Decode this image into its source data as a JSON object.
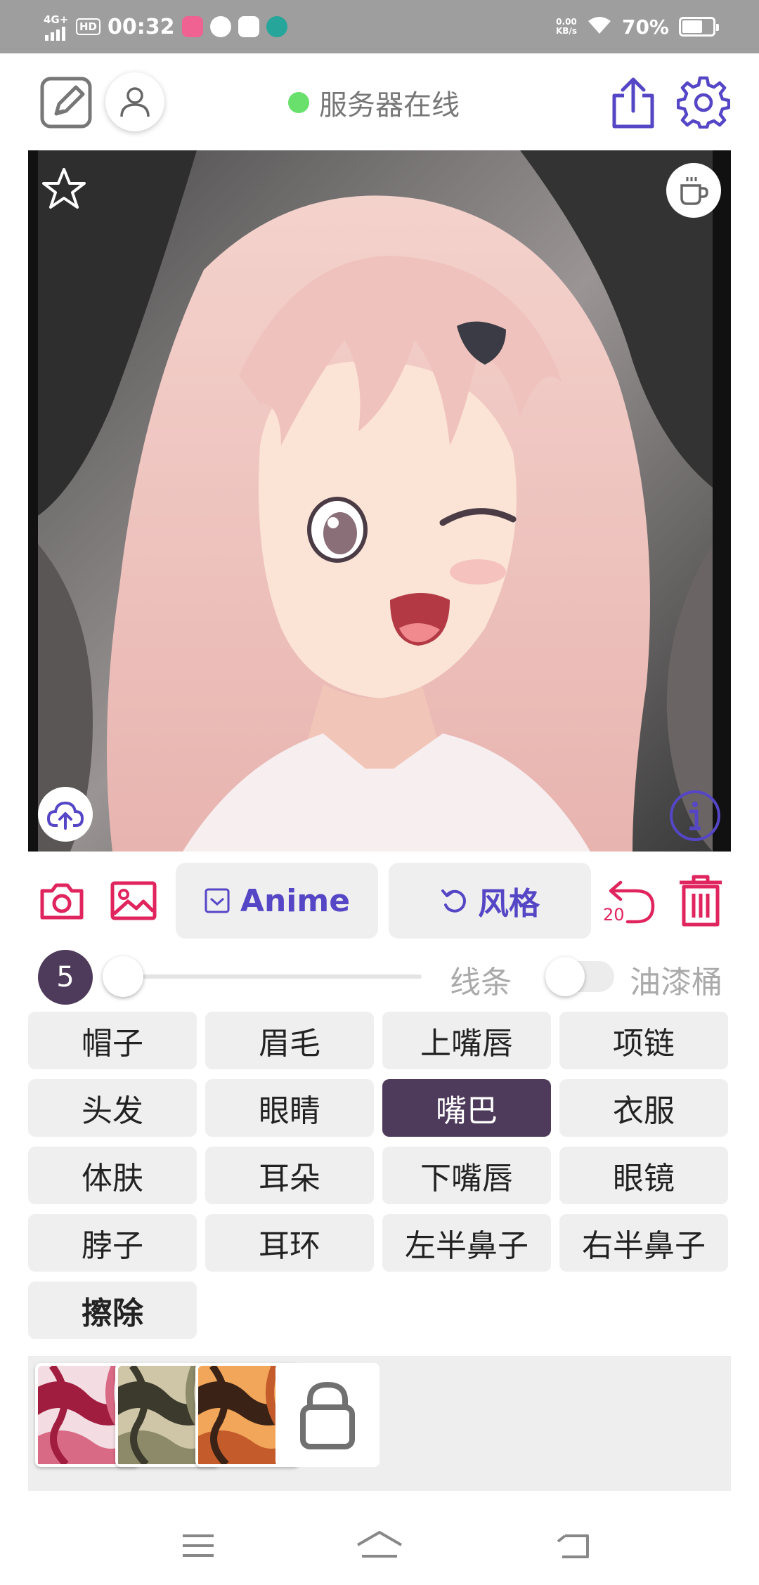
{
  "status_bar": {
    "network": "4G+",
    "hd": "HD",
    "time": "00:32",
    "speed_value": "0.00",
    "speed_unit": "KB/s",
    "battery": "70%"
  },
  "toolbar": {
    "server_status": "服务器在线",
    "server_color": "#69e06b"
  },
  "canvas": {
    "image": "anime-girl-pink-hair-winking"
  },
  "actions": {
    "model_label": "Anime",
    "style_label": "风格",
    "undo_count": "20",
    "accent_color": "#5546c6",
    "danger_color": "#e0245e"
  },
  "slider": {
    "brush_size": "5",
    "value_fraction": 0.0,
    "lines_label": "线条",
    "bucket_label": "油漆桶",
    "bucket_enabled": false
  },
  "labels": [
    {
      "text": "帽子",
      "selected": false
    },
    {
      "text": "眉毛",
      "selected": false
    },
    {
      "text": "上嘴唇",
      "selected": false
    },
    {
      "text": "项链",
      "selected": false
    },
    {
      "text": "头发",
      "selected": false
    },
    {
      "text": "眼睛",
      "selected": false
    },
    {
      "text": "嘴巴",
      "selected": true
    },
    {
      "text": "衣服",
      "selected": false
    },
    {
      "text": "体肤",
      "selected": false
    },
    {
      "text": "耳朵",
      "selected": false
    },
    {
      "text": "下嘴唇",
      "selected": false
    },
    {
      "text": "眼镜",
      "selected": false
    },
    {
      "text": "脖子",
      "selected": false
    },
    {
      "text": "耳环",
      "selected": false
    },
    {
      "text": "左半鼻子",
      "selected": false
    },
    {
      "text": "右半鼻子",
      "selected": false
    },
    {
      "text": "擦除",
      "selected": false,
      "bold": true
    }
  ],
  "selected_color": "#4e3a5a",
  "presets": [
    {
      "name": "preset-red-white",
      "colors": [
        "#f3dde3",
        "#a11d3f",
        "#d96a85"
      ]
    },
    {
      "name": "preset-olive-grey",
      "colors": [
        "#cfc6a8",
        "#3b3a2c",
        "#8d8a6a"
      ]
    },
    {
      "name": "preset-orange-tiger",
      "colors": [
        "#f2a65a",
        "#3a2316",
        "#c35b2a"
      ]
    },
    {
      "name": "preset-locked",
      "locked": true
    }
  ]
}
